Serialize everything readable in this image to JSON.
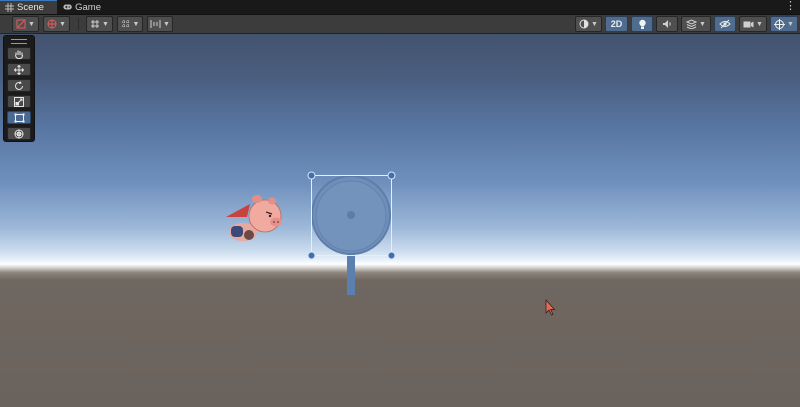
{
  "tabs": [
    {
      "label": "Scene",
      "icon": "grid-icon",
      "active": true
    },
    {
      "label": "Game",
      "icon": "gamepad-icon",
      "active": false
    }
  ],
  "toolbar": {
    "mode_2d_label": "2D",
    "mode_2d_enabled": true,
    "buttons": [
      "draw-mode-icon",
      "globe-icon",
      "grid-snap-icon",
      "grid-visibility-icon",
      "increment-snap-icon",
      "shading-icon",
      "lighting-icon",
      "audio-icon",
      "effects-icon",
      "hidden-objects-icon",
      "camera-icon",
      "gizmos-icon"
    ]
  },
  "tools": [
    {
      "name": "hand-tool",
      "icon": "hand-icon",
      "selected": false
    },
    {
      "name": "move-tool",
      "icon": "move-icon",
      "selected": false
    },
    {
      "name": "rotate-tool",
      "icon": "rotate-icon",
      "selected": false
    },
    {
      "name": "scale-tool",
      "icon": "scale-icon",
      "selected": false
    },
    {
      "name": "rect-tool",
      "icon": "rect-icon",
      "selected": true
    },
    {
      "name": "transform-tool",
      "icon": "transform-icon",
      "selected": false
    }
  ],
  "colors": {
    "accent": "#3a79bb",
    "selection_handle": "#3d6fb3",
    "target_fill": "#6f8fba",
    "ground": "#6a625c"
  }
}
